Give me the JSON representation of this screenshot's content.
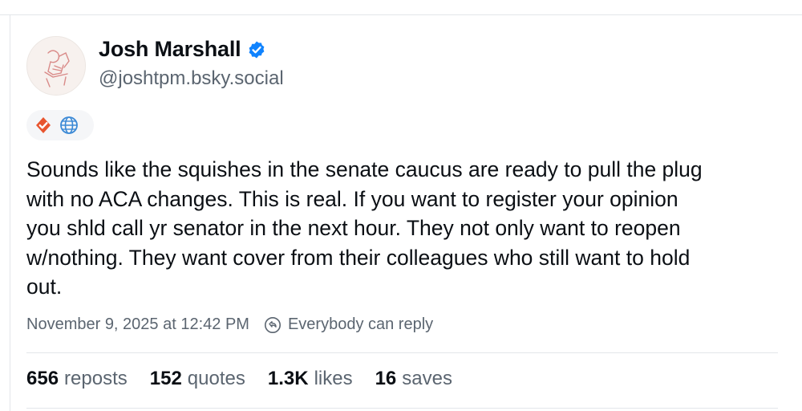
{
  "author": {
    "display_name": "Josh Marshall",
    "handle": "@joshtpm.bsky.social",
    "verified_icon": "verified-check-icon",
    "avatar_icon": "avatar-illustration"
  },
  "badges": [
    {
      "icon": "verifier-badge-icon",
      "color": "#e8552f"
    },
    {
      "icon": "globe-icon",
      "color": "#3c8ad6"
    }
  ],
  "post": {
    "lines": [
      "Sounds like the squishes in the senate caucus are ready to pull the plug",
      "with no ACA changes. This is real. If you want to register your opinion",
      "you shld call yr senator in the next hour. They not only want to reopen",
      "w/nothing. They want cover from their colleagues who still want to hold",
      "out."
    ]
  },
  "meta": {
    "timestamp": "November 9, 2025 at 12:42 PM",
    "reply_setting": "Everybody can reply",
    "reply_icon": "reply-settings-icon"
  },
  "stats": {
    "reposts": {
      "count": "656",
      "label": "reposts"
    },
    "quotes": {
      "count": "152",
      "label": "quotes"
    },
    "likes": {
      "count": "1.3K",
      "label": "likes"
    },
    "saves": {
      "count": "16",
      "label": "saves"
    }
  },
  "colors": {
    "text_primary": "#0b0f14",
    "text_secondary": "#5b6570",
    "verified_blue": "#1083fe",
    "divider": "#e3e6ea"
  }
}
